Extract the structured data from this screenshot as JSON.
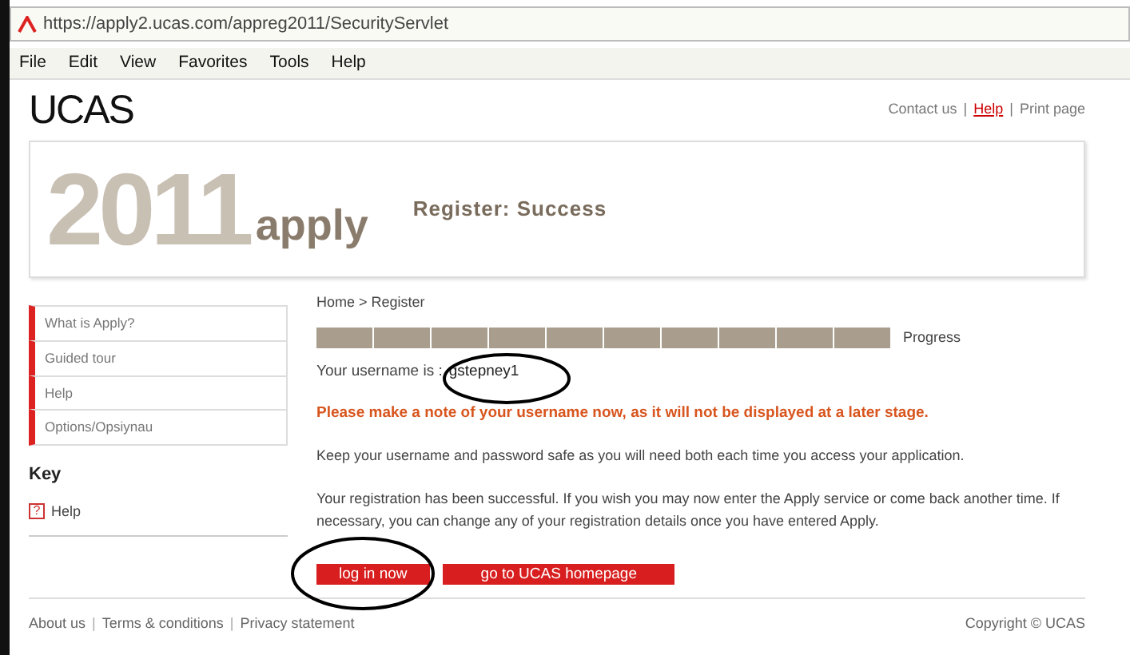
{
  "browser": {
    "address": "https://apply2.ucas.com/appreg2011/SecurityServlet",
    "menu": [
      "File",
      "Edit",
      "View",
      "Favorites",
      "Tools",
      "Help"
    ]
  },
  "header": {
    "logo": "UCAS",
    "links": [
      {
        "text": "Contact us",
        "kind": "plain"
      },
      {
        "text": "|",
        "kind": "separator"
      },
      {
        "text": "Help",
        "kind": "link"
      },
      {
        "text": "|",
        "kind": "separator"
      },
      {
        "text": "Print page",
        "kind": "plain"
      }
    ]
  },
  "banner": {
    "year": "2011",
    "product": "apply",
    "title": "Register: Success"
  },
  "sidebar": {
    "items": [
      "What is Apply?",
      "Guided tour",
      "Help",
      "Options/Opsiynau"
    ],
    "key_title": "Key",
    "key_items": [
      {
        "icon": "?",
        "text": "Help"
      }
    ]
  },
  "main": {
    "breadcrumb": "Home > Register",
    "progress": {
      "label": "Progress",
      "level": 1
    },
    "username_label": "Your username is :",
    "username": "gstepney1",
    "warning": "Please make a note of your username now, as it will not be displayed at a later stage.",
    "paragraphs": [
      "Keep your username and password safe as you will need both each time you access your application.",
      "Your registration has been successful. If you wish you may now enter the Apply service or come back another time. If necessary, you can change any of your registration details once you have entered Apply."
    ],
    "buttons": [
      "log in now",
      "go to UCAS homepage"
    ]
  },
  "footer": {
    "links": [
      {
        "text": "About us",
        "kind": "link"
      },
      {
        "text": "|",
        "kind": "separator"
      },
      {
        "text": "Terms & conditions",
        "kind": "link"
      },
      {
        "text": "|",
        "kind": "separator"
      },
      {
        "text": "Privacy statement",
        "kind": "link"
      }
    ],
    "copyright": "Copyright © UCAS"
  }
}
